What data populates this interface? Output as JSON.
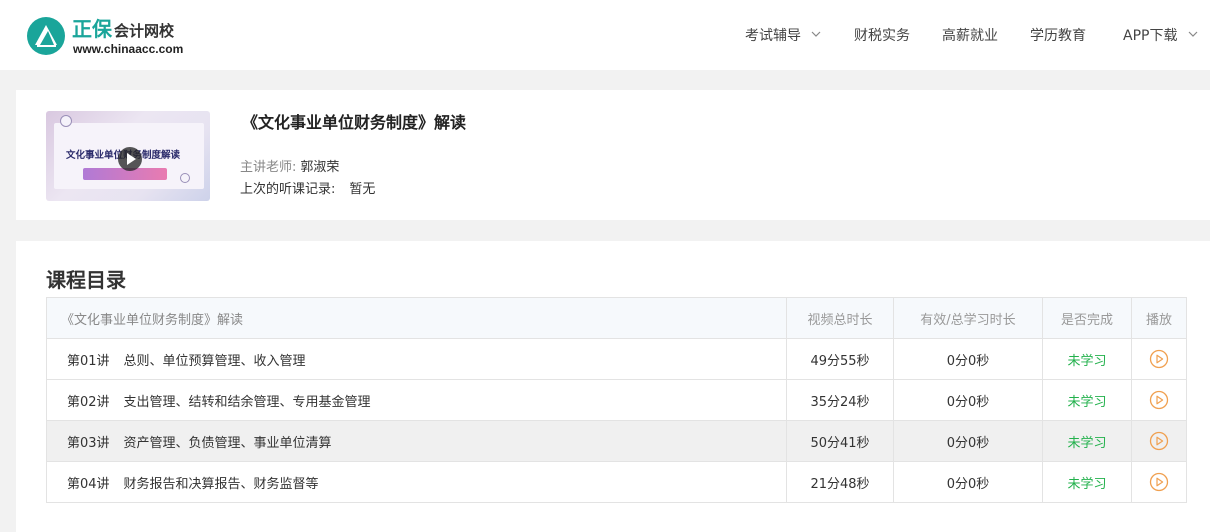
{
  "header": {
    "logo_cn": "正保",
    "logo_sub": "会计网校",
    "logo_url": "www.chinaacc.com",
    "nav": [
      {
        "label": "考试辅导",
        "dropdown": true
      },
      {
        "label": "财税实务",
        "dropdown": false
      },
      {
        "label": "高薪就业",
        "dropdown": false
      },
      {
        "label": "学历教育",
        "dropdown": false
      },
      {
        "label": "APP下载",
        "dropdown": true
      }
    ]
  },
  "course": {
    "title": "《文化事业单位财务制度》解读",
    "thumb_title": "文化事业单位财务制度解读",
    "teacher_label": "主讲老师:",
    "teacher": "郭淑荣",
    "last_label": "上次的听课记录:",
    "last_value": "暂无"
  },
  "catalog": {
    "title": "课程目录",
    "columns": [
      "《文化事业单位财务制度》解读",
      "视频总时长",
      "有效/总学习时长",
      "是否完成",
      "播放"
    ],
    "rows": [
      {
        "no": "第01讲",
        "name": "总则、单位预算管理、收入管理",
        "duration": "49分55秒",
        "studied": "0分0秒",
        "status": "未学习"
      },
      {
        "no": "第02讲",
        "name": "支出管理、结转和结余管理、专用基金管理",
        "duration": "35分24秒",
        "studied": "0分0秒",
        "status": "未学习"
      },
      {
        "no": "第03讲",
        "name": "资产管理、负债管理、事业单位清算",
        "duration": "50分41秒",
        "studied": "0分0秒",
        "status": "未学习"
      },
      {
        "no": "第04讲",
        "name": "财务报告和决算报告、财务监督等",
        "duration": "21分48秒",
        "studied": "0分0秒",
        "status": "未学习"
      }
    ]
  },
  "colors": {
    "brand": "#1aa59a",
    "status_green": "#22b14c",
    "play_orange": "#f0a050"
  },
  "icons": [
    "logo-icon",
    "chevron-down-icon",
    "play-icon",
    "play-circle-icon"
  ]
}
